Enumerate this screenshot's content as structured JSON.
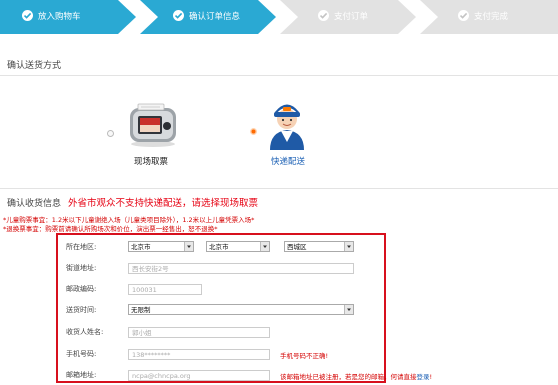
{
  "steps": [
    {
      "label": "放入购物车",
      "state": "done"
    },
    {
      "label": "确认订单信息",
      "state": "active"
    },
    {
      "label": "支付订单",
      "state": "todo"
    },
    {
      "label": "支付完成",
      "state": "todo"
    }
  ],
  "colors": {
    "step_done": "#2aa9d3",
    "step_todo": "#e2e2e2",
    "accent_red": "#d40000",
    "link_blue": "#1a5fb4"
  },
  "delivery": {
    "title": "确认送货方式",
    "options": [
      {
        "label": "现场取票",
        "icon": "ticket-machine-icon",
        "selected": false
      },
      {
        "label": "快递配送",
        "icon": "courier-icon",
        "selected": true
      }
    ]
  },
  "receiver": {
    "title": "确认收货信息",
    "warning": "外省市观众不支持快递配送，请选择现场取票",
    "notice1": "*儿童购票事宜：1.2米以下儿童谢绝入场（儿童类项目除外），1.2米以上儿童凭票入场*",
    "notice2": "*退换票事宜：购票前请确认所购场次和价位，演出票一经售出，恕不退换*"
  },
  "form": {
    "region_label": "所在地区:",
    "province": "北京市",
    "city": "北京市",
    "district": "西城区",
    "street_label": "街道地址:",
    "street_value": "西长安街2号",
    "zip_label": "邮政编码:",
    "zip_value": "100031",
    "time_label": "送货时间:",
    "time_value": "无限制",
    "name_label": "收货人姓名:",
    "name_value": "郭小姐",
    "phone_label": "手机号码:",
    "phone_value": "138********",
    "phone_error": "手机号码不正确!",
    "email_label": "邮箱地址:",
    "email_value": "ncpa@chncpa.org",
    "email_error": "该邮箱地址已被注册，若是您的邮箱，何请直接",
    "email_link": "登录"
  }
}
